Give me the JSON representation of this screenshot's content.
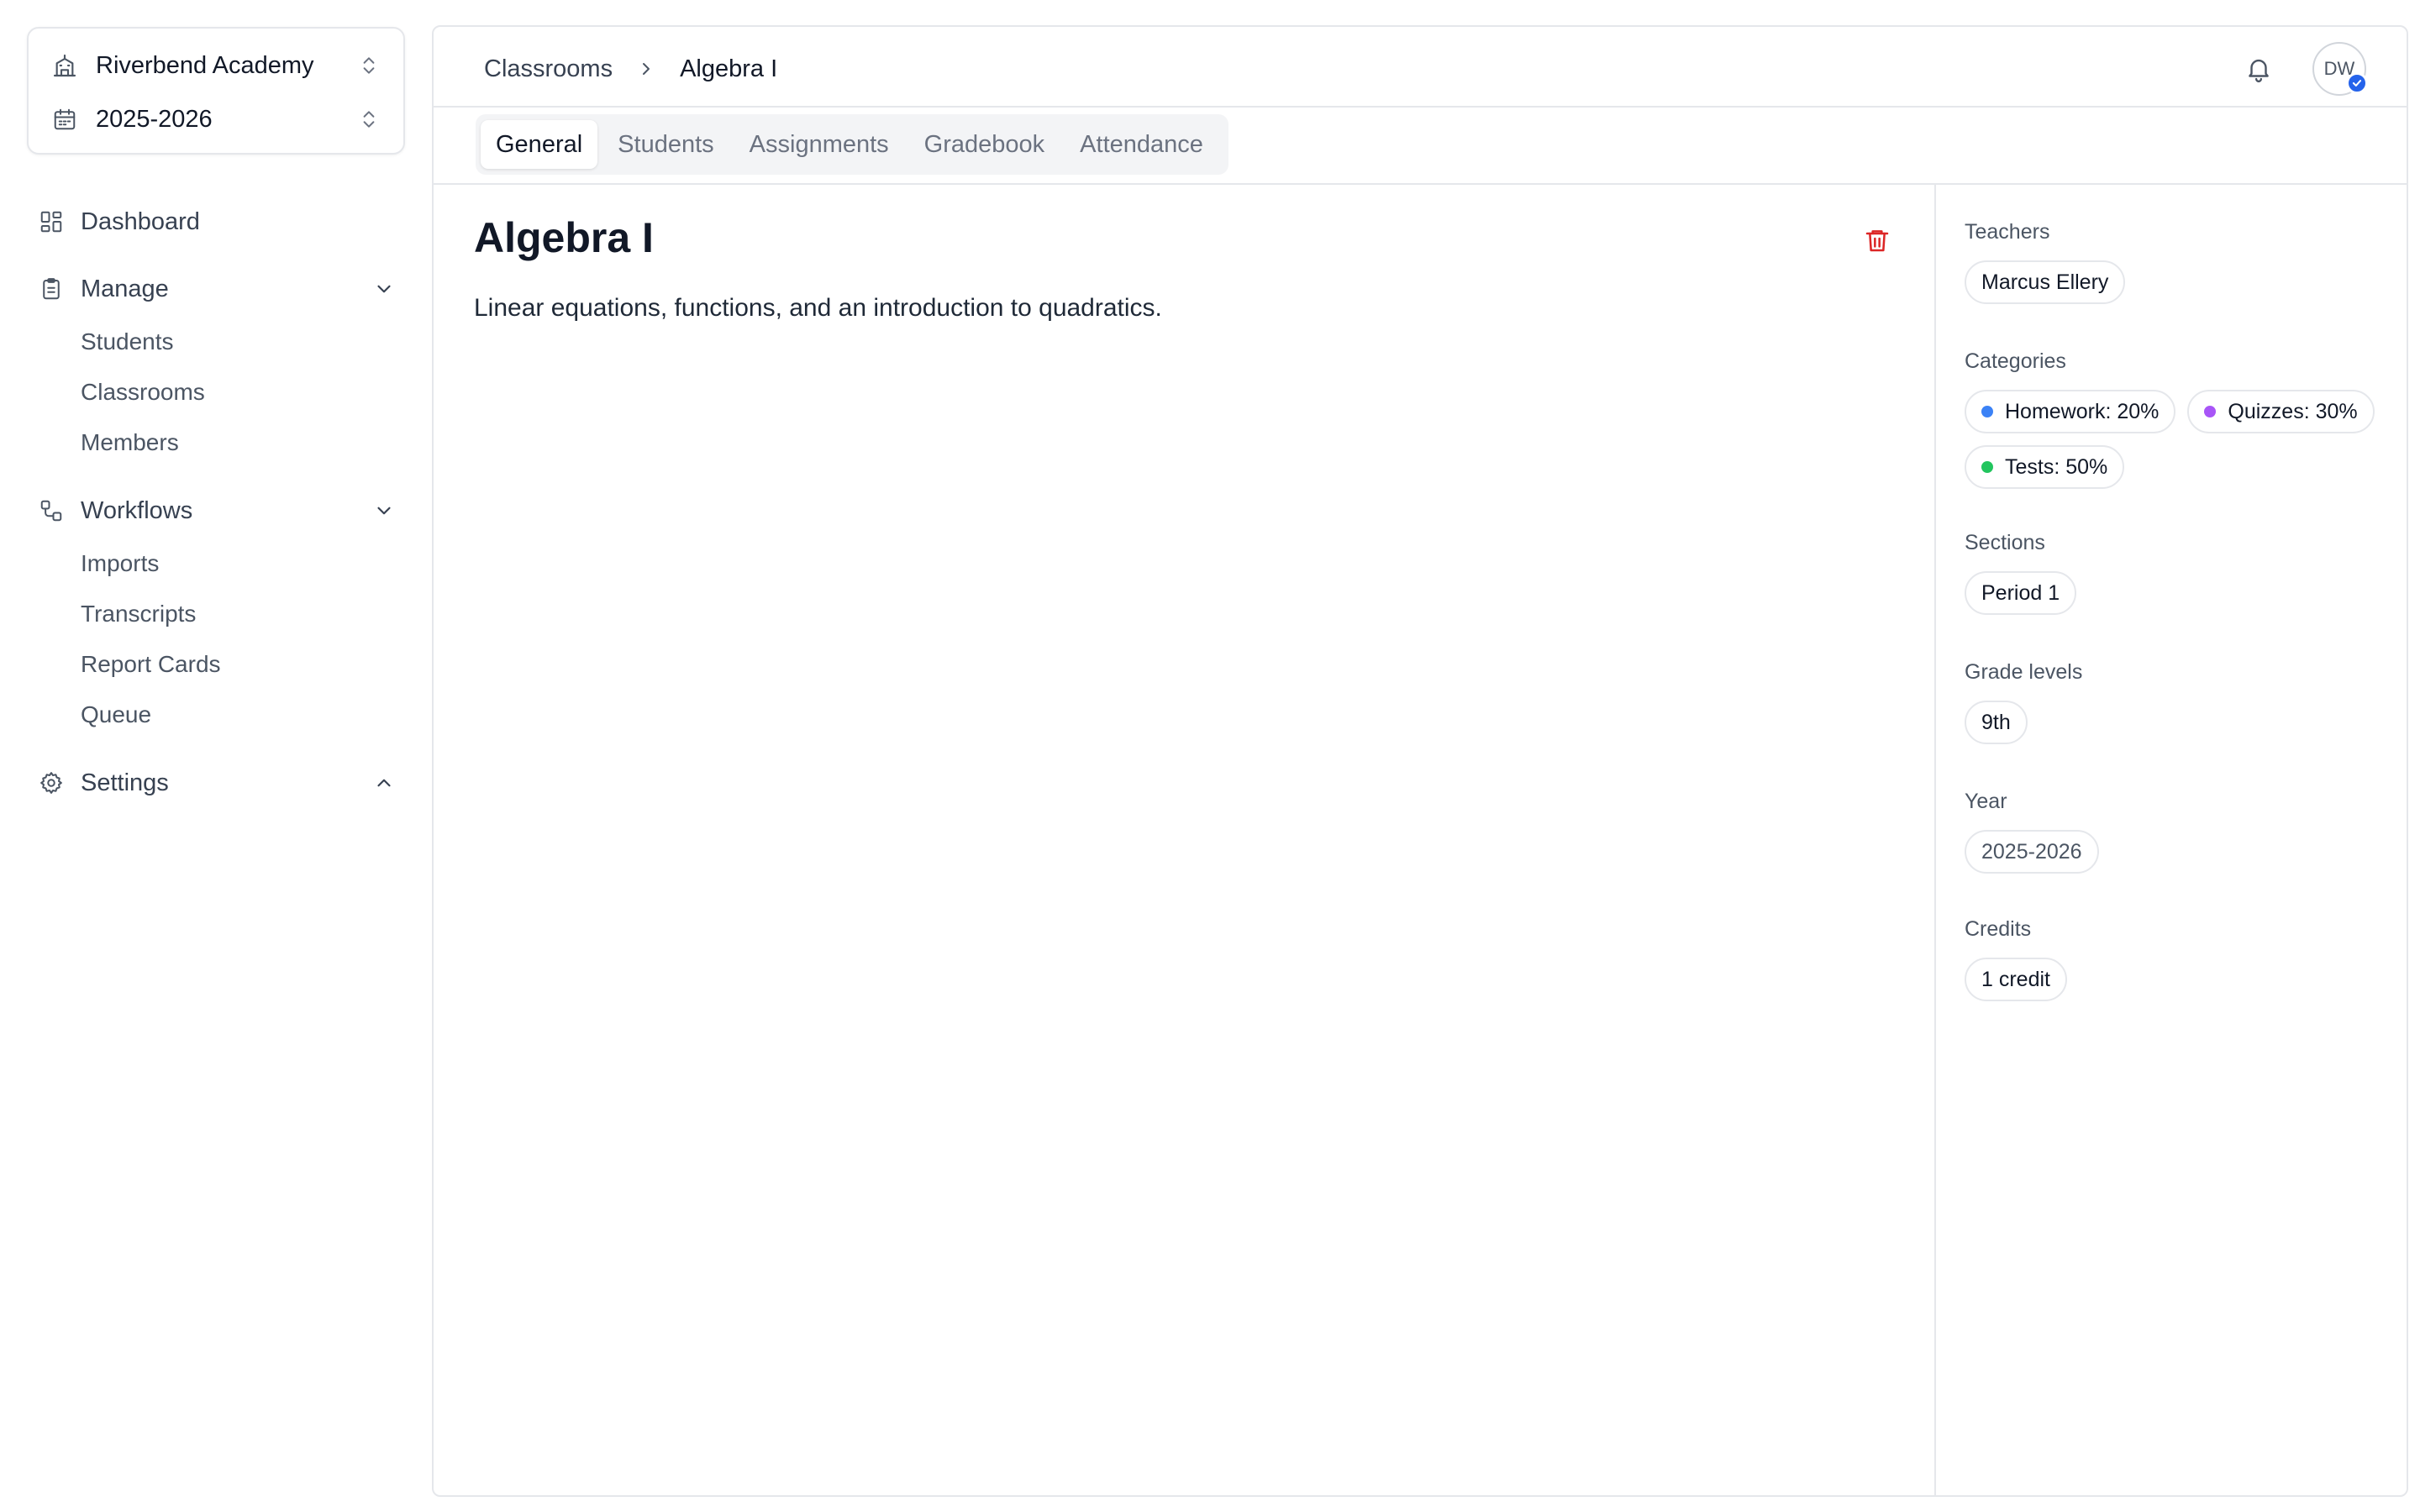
{
  "org_switcher": {
    "school": "Riverbend Academy",
    "year": "2025-2026"
  },
  "nav": {
    "dashboard": "Dashboard",
    "manage": {
      "label": "Manage",
      "items": [
        "Students",
        "Classrooms",
        "Members"
      ]
    },
    "workflows": {
      "label": "Workflows",
      "items": [
        "Imports",
        "Transcripts",
        "Report Cards",
        "Queue"
      ]
    },
    "settings": "Settings"
  },
  "breadcrumb": {
    "parent": "Classrooms",
    "current": "Algebra I"
  },
  "user": {
    "initials": "DW"
  },
  "tabs": [
    "General",
    "Students",
    "Assignments",
    "Gradebook",
    "Attendance"
  ],
  "active_tab": "General",
  "classroom": {
    "title": "Algebra I",
    "description": "Linear equations, functions, and an introduction to quadratics."
  },
  "details": {
    "teachers": {
      "label": "Teachers",
      "values": [
        "Marcus Ellery"
      ]
    },
    "categories": {
      "label": "Categories",
      "values": [
        {
          "text": "Homework: 20%",
          "color": "#3b82f6"
        },
        {
          "text": "Quizzes: 30%",
          "color": "#a855f7"
        },
        {
          "text": "Tests: 50%",
          "color": "#22c55e"
        }
      ]
    },
    "sections": {
      "label": "Sections",
      "values": [
        "Period 1"
      ]
    },
    "grade_levels": {
      "label": "Grade levels",
      "values": [
        "9th"
      ]
    },
    "year": {
      "label": "Year",
      "values": [
        "2025-2026"
      ]
    },
    "credits": {
      "label": "Credits",
      "values": [
        "1 credit"
      ]
    }
  },
  "colors": {
    "accent": "#2563eb",
    "danger": "#dc2626",
    "border": "#e5e7eb"
  }
}
